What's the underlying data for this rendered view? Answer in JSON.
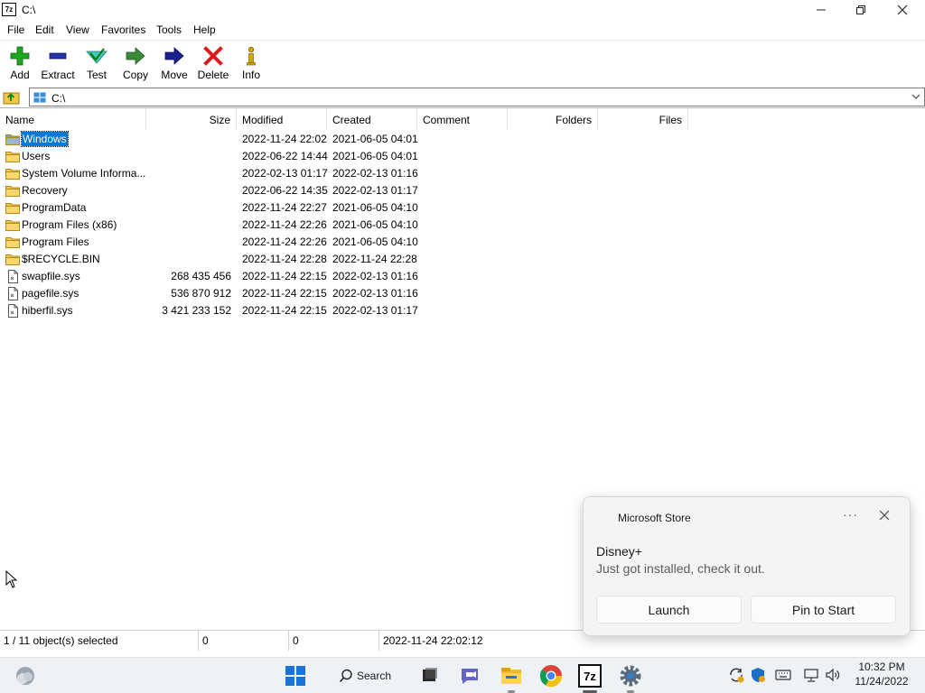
{
  "window": {
    "title": "C:\\",
    "app_icon_text": "7z"
  },
  "menu": [
    "File",
    "Edit",
    "View",
    "Favorites",
    "Tools",
    "Help"
  ],
  "toolbar": [
    {
      "label": "Add",
      "icon": "add-icon"
    },
    {
      "label": "Extract",
      "icon": "extract-icon"
    },
    {
      "label": "Test",
      "icon": "test-icon"
    },
    {
      "label": "Copy",
      "icon": "copy-icon"
    },
    {
      "label": "Move",
      "icon": "move-icon"
    },
    {
      "label": "Delete",
      "icon": "delete-icon"
    },
    {
      "label": "Info",
      "icon": "info-icon"
    }
  ],
  "address": {
    "path": "C:\\"
  },
  "columns": [
    "Name",
    "Size",
    "Modified",
    "Created",
    "Comment",
    "Folders",
    "Files"
  ],
  "rows": [
    {
      "name": "Windows",
      "size": "",
      "modified": "2022-11-24 22:02",
      "created": "2021-06-05 04:01",
      "type": "folder",
      "selected": true
    },
    {
      "name": "Users",
      "size": "",
      "modified": "2022-06-22 14:44",
      "created": "2021-06-05 04:01",
      "type": "folder"
    },
    {
      "name": "System Volume Informa...",
      "size": "",
      "modified": "2022-02-13 01:17",
      "created": "2022-02-13 01:16",
      "type": "folder"
    },
    {
      "name": "Recovery",
      "size": "",
      "modified": "2022-06-22 14:35",
      "created": "2022-02-13 01:17",
      "type": "folder"
    },
    {
      "name": "ProgramData",
      "size": "",
      "modified": "2022-11-24 22:27",
      "created": "2021-06-05 04:10",
      "type": "folder"
    },
    {
      "name": "Program Files (x86)",
      "size": "",
      "modified": "2022-11-24 22:26",
      "created": "2021-06-05 04:10",
      "type": "folder"
    },
    {
      "name": "Program Files",
      "size": "",
      "modified": "2022-11-24 22:26",
      "created": "2021-06-05 04:10",
      "type": "folder"
    },
    {
      "name": "$RECYCLE.BIN",
      "size": "",
      "modified": "2022-11-24 22:28",
      "created": "2022-11-24 22:28",
      "type": "folder"
    },
    {
      "name": "swapfile.sys",
      "size": "268 435 456",
      "modified": "2022-11-24 22:15",
      "created": "2022-02-13 01:16",
      "type": "file"
    },
    {
      "name": "pagefile.sys",
      "size": "536 870 912",
      "modified": "2022-11-24 22:15",
      "created": "2022-02-13 01:16",
      "type": "file"
    },
    {
      "name": "hiberfil.sys",
      "size": "3 421 233 152",
      "modified": "2022-11-24 22:15",
      "created": "2022-02-13 01:17",
      "type": "file"
    }
  ],
  "status": {
    "selection": "1 / 11 object(s) selected",
    "size": "0",
    "packed": "0",
    "datetime": "2022-11-24 22:02:12"
  },
  "toast": {
    "app": "Microsoft Store",
    "more": "···",
    "title": "Disney+",
    "body": "Just got installed, check it out.",
    "button_launch": "Launch",
    "button_pin": "Pin to Start"
  },
  "taskbar": {
    "search_label": "Search",
    "time": "10:32 PM",
    "date": "11/24/2022",
    "sevenzip_text": "7z"
  },
  "colors": {
    "selection": "#0078d7",
    "folder": "#f2c84b",
    "taskbar": "#eef2f6"
  }
}
